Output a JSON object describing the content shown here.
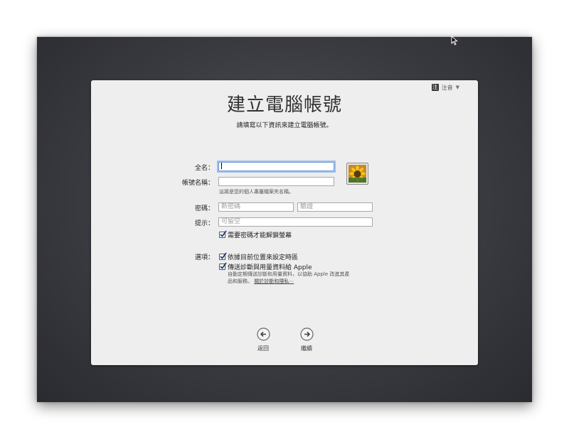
{
  "ime": {
    "label": "注音",
    "box": "注",
    "arrow": "▼"
  },
  "title": "建立電腦帳號",
  "subtitle": "請填寫以下資訊來建立電腦帳號。",
  "form": {
    "fullname_label": "全名：",
    "fullname_value": "",
    "account_label": "帳號名稱：",
    "account_value": "",
    "account_hint": "這將是您的個人專屬檔案夾名稱。",
    "password_label": "密碼：",
    "password_placeholder": "新密碼",
    "verify_placeholder": "驗證",
    "hint_label": "提示：",
    "hint_placeholder": "可留空",
    "require_password_label": "需要密碼才能解鎖螢幕",
    "options_label": "選項：",
    "location_label": "依據目前位置來設定時區",
    "diagnostics_label": "傳送診斷與用量資料給 Apple",
    "diagnostics_desc": "自動定期傳送診斷和用量資料，以協助 Apple 改進其產品和服務。",
    "diagnostics_link": "關於診斷和隱私⋯"
  },
  "nav": {
    "back_label": "返回",
    "continue_label": "繼續"
  },
  "checks": {
    "require_password": true,
    "location": true,
    "diagnostics": true
  }
}
